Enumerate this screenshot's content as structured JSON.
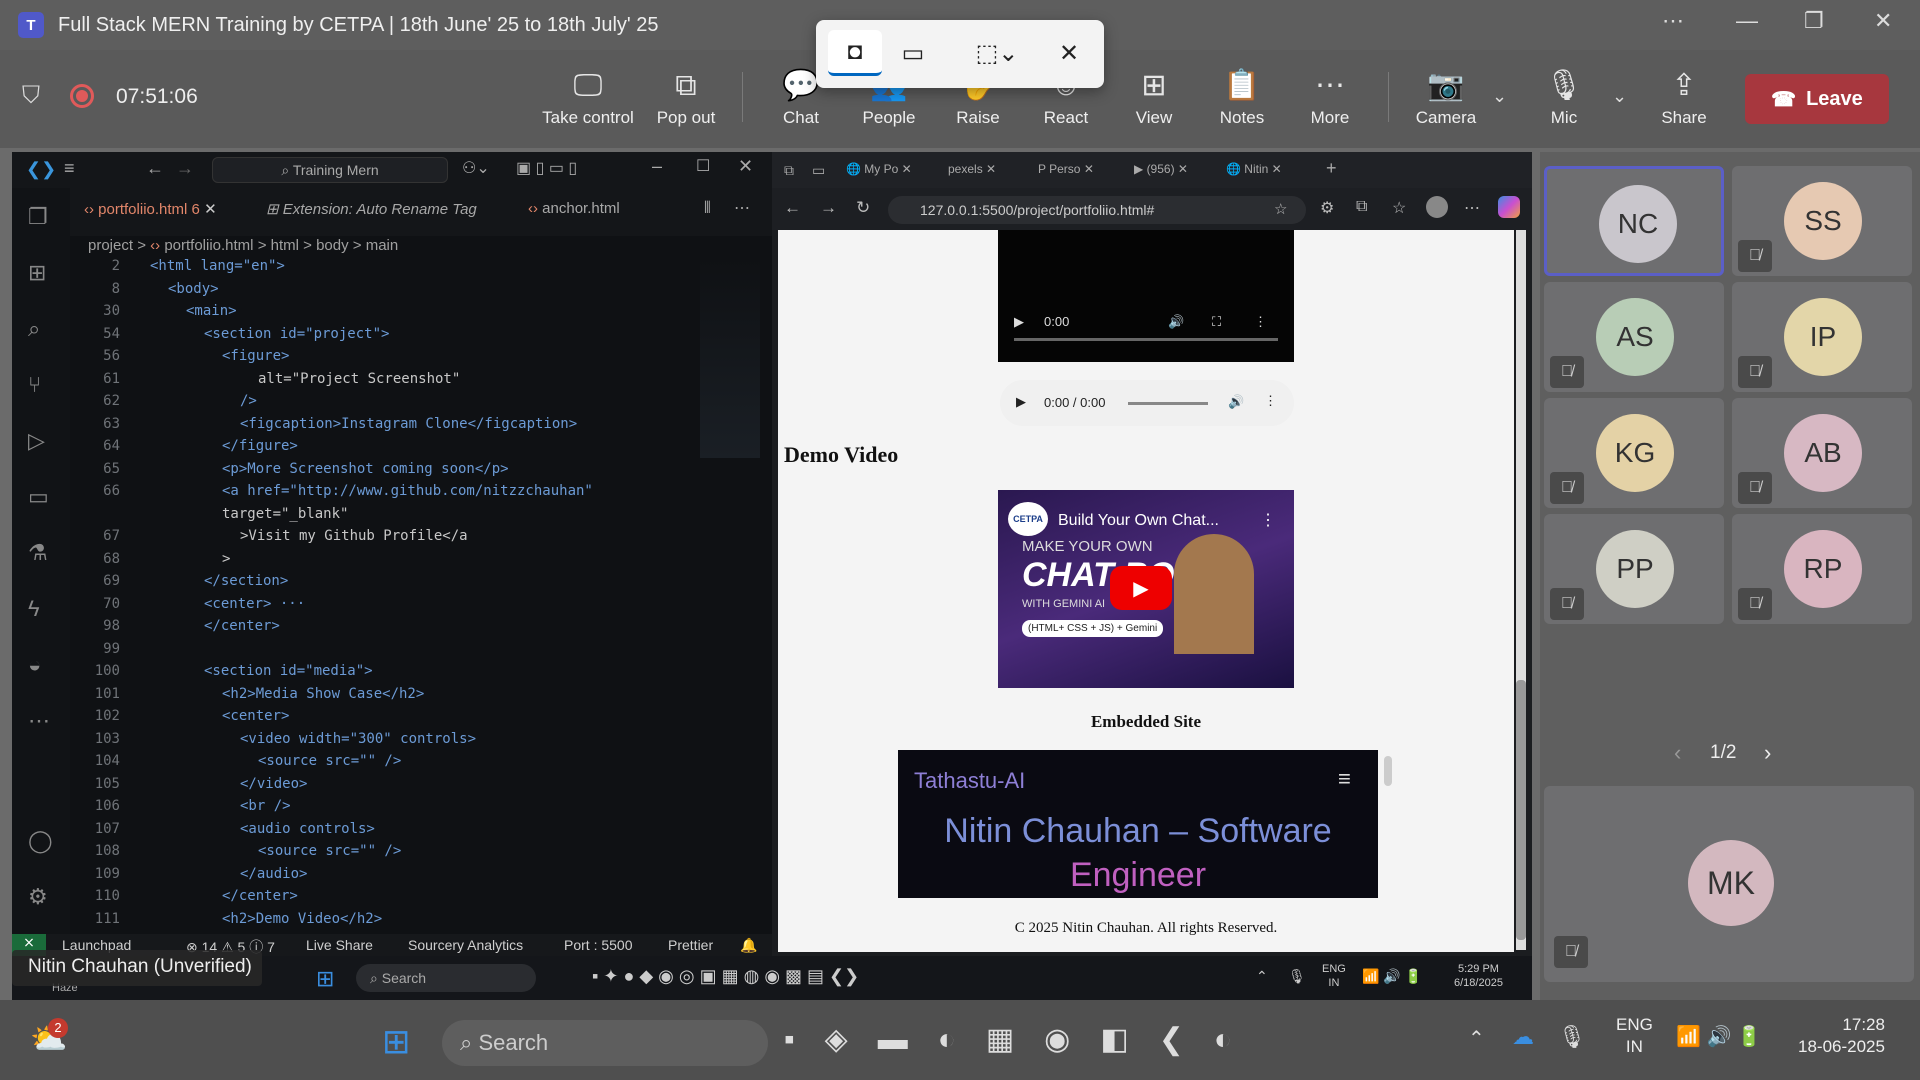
{
  "window": {
    "title": "Full Stack MERN Training by CETPA | 18th June' 25 to 18th July' 25",
    "logo": "T"
  },
  "meeting": {
    "timer": "07:51:06"
  },
  "toolbar": {
    "items": [
      {
        "label": "Take control",
        "icon": "take-control-icon"
      },
      {
        "label": "Pop out",
        "icon": "pop-out-icon"
      },
      {
        "label": "Chat",
        "icon": "chat-icon"
      },
      {
        "label": "People",
        "icon": "people-icon"
      },
      {
        "label": "Raise",
        "icon": "raise-hand-icon"
      },
      {
        "label": "React",
        "icon": "react-icon"
      },
      {
        "label": "View",
        "icon": "view-icon"
      },
      {
        "label": "Notes",
        "icon": "notes-icon"
      },
      {
        "label": "More",
        "icon": "more-icon"
      },
      {
        "label": "Camera",
        "icon": "camera-off-icon"
      },
      {
        "label": "Mic",
        "icon": "mic-off-icon"
      },
      {
        "label": "Share",
        "icon": "share-icon"
      }
    ],
    "leave": "Leave"
  },
  "vscode": {
    "search": "Training Mern",
    "tabs": [
      {
        "label": "portfoliio.html",
        "badge": "6"
      },
      {
        "label": "Extension: Auto Rename Tag"
      },
      {
        "label": "anchor.html"
      }
    ],
    "breadcrumb": [
      "project",
      ">",
      "portfoliio.html",
      ">",
      "html",
      ">",
      "body",
      ">",
      "main"
    ],
    "lines": [
      {
        "n": "2",
        "indent": 0,
        "code": "<html lang=\"en\">"
      },
      {
        "n": "8",
        "indent": 1,
        "code": "<body>"
      },
      {
        "n": "30",
        "indent": 2,
        "code": "<main>"
      },
      {
        "n": "54",
        "indent": 3,
        "code": "<section id=\"project\">"
      },
      {
        "n": "56",
        "indent": 4,
        "code": "<figure>"
      },
      {
        "n": "61",
        "indent": 6,
        "code": "alt=\"Project Screenshot\""
      },
      {
        "n": "62",
        "indent": 5,
        "code": "/>"
      },
      {
        "n": "63",
        "indent": 5,
        "code": "<figcaption>Instagram Clone</figcaption>"
      },
      {
        "n": "64",
        "indent": 4,
        "code": "</figure>"
      },
      {
        "n": "65",
        "indent": 4,
        "code": "<p>More Screenshot coming soon</p>"
      },
      {
        "n": "66",
        "indent": 4,
        "code": "<a href=\"http://www.github.com/nitzzchauhan\""
      },
      {
        "n": "",
        "indent": 4,
        "code": "target=\"_blank\""
      },
      {
        "n": "67",
        "indent": 5,
        "code": ">Visit my Github Profile</a"
      },
      {
        "n": "68",
        "indent": 4,
        "code": ">"
      },
      {
        "n": "69",
        "indent": 3,
        "code": "</section>"
      },
      {
        "n": "70",
        "indent": 3,
        "code": "<center> ···"
      },
      {
        "n": "98",
        "indent": 3,
        "code": "</center>"
      },
      {
        "n": "99",
        "indent": 0,
        "code": ""
      },
      {
        "n": "100",
        "indent": 3,
        "code": "<section id=\"media\">"
      },
      {
        "n": "101",
        "indent": 4,
        "code": "<h2>Media Show Case</h2>"
      },
      {
        "n": "102",
        "indent": 4,
        "code": "<center>"
      },
      {
        "n": "103",
        "indent": 5,
        "code": "<video width=\"300\" controls>"
      },
      {
        "n": "104",
        "indent": 6,
        "code": "<source src=\"\" />"
      },
      {
        "n": "105",
        "indent": 5,
        "code": "</video>"
      },
      {
        "n": "106",
        "indent": 5,
        "code": "<br />"
      },
      {
        "n": "107",
        "indent": 5,
        "code": "<audio controls>"
      },
      {
        "n": "108",
        "indent": 6,
        "code": "<source src=\"\" />"
      },
      {
        "n": "109",
        "indent": 5,
        "code": "</audio>"
      },
      {
        "n": "110",
        "indent": 4,
        "code": "</center>"
      },
      {
        "n": "111",
        "indent": 4,
        "code": "<h2>Demo Video</h2>"
      }
    ],
    "status": {
      "launchpad": "Launchpad",
      "problems": "⊗ 14 ⚠ 5 ⓘ 7",
      "liveshare": "Live Share",
      "sourcery": "Sourcery Analytics",
      "port": "Port : 5500",
      "prettier": "Prettier"
    }
  },
  "edge": {
    "tabs": [
      "My Po",
      "pexels",
      "Perso",
      "(956)",
      "Nitin"
    ],
    "url": "127.0.0.1:5500/project/portfoliio.html#",
    "page": {
      "video_time": "0:00",
      "audio_time": "0:00 / 0:00",
      "demo_heading": "Demo Video",
      "yt_title": "Build Your Own Chat...",
      "yt_brand": "CETPA",
      "yt_line1": "MAKE YOUR OWN",
      "yt_line2": "CHAT BOT",
      "yt_line3": "WITH GEMINI AI",
      "yt_line4": "(HTML+ CSS + JS) + Gemini",
      "embedded_heading": "Embedded Site",
      "site_brand": "Tathastu-AI",
      "site_title1": "Nitin Chauhan – Software",
      "site_title2": "Engineer",
      "footer": "C 2025 Nitin Chauhan. All rights Reserved."
    }
  },
  "inner_taskbar": {
    "search": "Search",
    "lang1": "ENG",
    "lang2": "IN",
    "time": "5:29 PM",
    "date": "6/18/2025",
    "weather": "Haze"
  },
  "presenter": "Nitin Chauhan (Unverified)",
  "participants": [
    {
      "initials": "NC",
      "color": "#c9c6cc",
      "muted": false,
      "active": true
    },
    {
      "initials": "SS",
      "color": "#e6c9b2",
      "muted": true
    },
    {
      "initials": "AS",
      "color": "#b8cdb6",
      "muted": true
    },
    {
      "initials": "IP",
      "color": "#e3d6a9",
      "muted": true
    },
    {
      "initials": "KG",
      "color": "#e4d2a6",
      "muted": true
    },
    {
      "initials": "AB",
      "color": "#d7b8c3",
      "muted": true
    },
    {
      "initials": "PP",
      "color": "#cfcfc5",
      "muted": true
    },
    {
      "initials": "RP",
      "color": "#d9b5c0",
      "muted": true
    }
  ],
  "pager": "1/2",
  "self": {
    "initials": "MK",
    "color": "#d3b8bf"
  },
  "taskbar": {
    "search": "Search",
    "badge": "2",
    "lang1": "ENG",
    "lang2": "IN",
    "time": "17:28",
    "date": "18-06-2025"
  }
}
